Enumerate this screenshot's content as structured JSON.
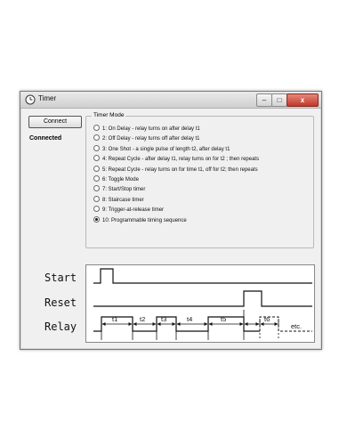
{
  "window": {
    "title": "Timer",
    "controls": {
      "minimize": "–",
      "maximize": "□",
      "close": "x"
    }
  },
  "connection": {
    "button_label": "Connect",
    "status": "Connected"
  },
  "timer_mode": {
    "group_title": "Timer Mode",
    "selected_index": 9,
    "options": [
      "1: On Delay - relay turns on after delay t1",
      "2: Off Delay - relay turns off after delay t1",
      "3: One Shot - a single pulse of length t2, after delay t1",
      "4: Repeat Cycle - after delay t1, relay turns on for t2 ; then repeats",
      "5: Repeat Cycle - relay turns on for time t1, off for t2; then repeats",
      "6: Toggle Mode",
      "7: Start/Stop timer",
      "8: Staircase timer",
      "9: Trigger-at-release timer",
      "10: Programmable timing sequence"
    ]
  },
  "timing_diagram": {
    "signals": [
      "Start",
      "Reset",
      "Relay"
    ],
    "intervals": [
      "t1",
      "t2",
      "t3",
      "t4",
      "t5",
      "t6",
      "etc."
    ]
  }
}
